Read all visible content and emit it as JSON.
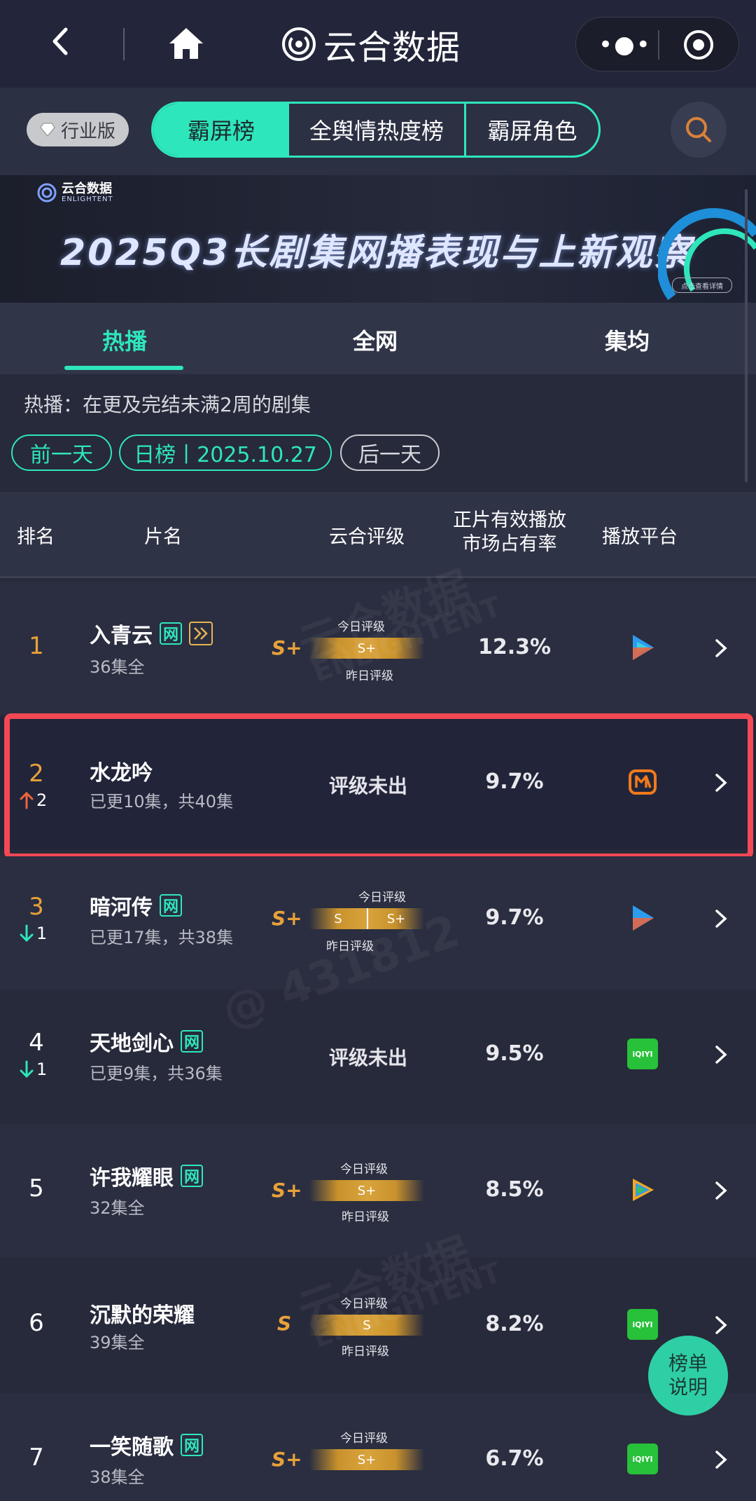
{
  "app": {
    "title": "云合数据"
  },
  "tabbar": {
    "industry": "行业版",
    "tabs": [
      "霸屏榜",
      "全舆情热度榜",
      "霸屏角色"
    ]
  },
  "banner": {
    "logo_text": "云合数据",
    "logo_sub": "ENLIGHTENT",
    "headline": "2025Q3长剧集网播表现与上新观察",
    "cta": "点击查看详情"
  },
  "subtabs": [
    "热播",
    "全网",
    "集均"
  ],
  "description": "热播：在更及完结未满2周的剧集",
  "date_nav": {
    "prev": "前一天",
    "current": "日榜丨2025.10.27",
    "next": "后一天"
  },
  "columns": {
    "rank": "排名",
    "title": "片名",
    "rating": "云合评级",
    "share_line1": "正片有效播放",
    "share_line2": "市场占有率",
    "platform": "播放平台"
  },
  "rating_labels": {
    "today": "今日评级",
    "yesterday": "昨日评级",
    "none": "评级未出"
  },
  "rows": [
    {
      "rank": "1",
      "title": "入青云",
      "sub": "36集全",
      "grade": "S+",
      "meter": "S+",
      "share": "12.3%",
      "platform": "tencent-video",
      "trend": "",
      "trend_num": ""
    },
    {
      "rank": "2",
      "title": "水龙吟",
      "sub": "已更10集，共40集",
      "grade": "",
      "meter": "",
      "share": "9.7%",
      "platform": "mango-tv",
      "trend": "up",
      "trend_num": "2"
    },
    {
      "rank": "3",
      "title": "暗河传",
      "sub": "已更17集，共38集",
      "grade": "S+",
      "meter_left": "S",
      "meter_right": "S+",
      "share": "9.7%",
      "platform": "tencent-video",
      "trend": "down",
      "trend_num": "1"
    },
    {
      "rank": "4",
      "title": "天地剑心",
      "sub": "已更9集，共36集",
      "grade": "",
      "meter": "",
      "share": "9.5%",
      "platform": "iqiyi",
      "trend": "down",
      "trend_num": "1"
    },
    {
      "rank": "5",
      "title": "许我耀眼",
      "sub": "32集全",
      "grade": "S+",
      "meter": "S+",
      "share": "8.5%",
      "platform": "tencent-video-2",
      "trend": "",
      "trend_num": ""
    },
    {
      "rank": "6",
      "title": "沉默的荣耀",
      "sub": "39集全",
      "grade": "S",
      "meter": "S",
      "share": "8.2%",
      "platform": "iqiyi",
      "trend": "",
      "trend_num": ""
    },
    {
      "rank": "7",
      "title": "一笑随歌",
      "sub": "38集全",
      "grade": "S+",
      "meter": "S+",
      "share": "6.7%",
      "platform": "iqiyi",
      "trend": "",
      "trend_num": ""
    }
  ],
  "badges": {
    "net": "网"
  },
  "platform_labels": {
    "iqiyi": "iQIYI"
  },
  "watermarks": {
    "brand": "云合数据",
    "brand_en": "ENLIGHTENT",
    "handle": "@ 431812"
  },
  "fab": {
    "line1": "榜单",
    "line2": "说明"
  },
  "colors": {
    "accent": "#2ee6bb",
    "highlight": "#f24954",
    "gold": "#e8a13a",
    "up": "#f0643c",
    "down": "#2ee6bb"
  }
}
